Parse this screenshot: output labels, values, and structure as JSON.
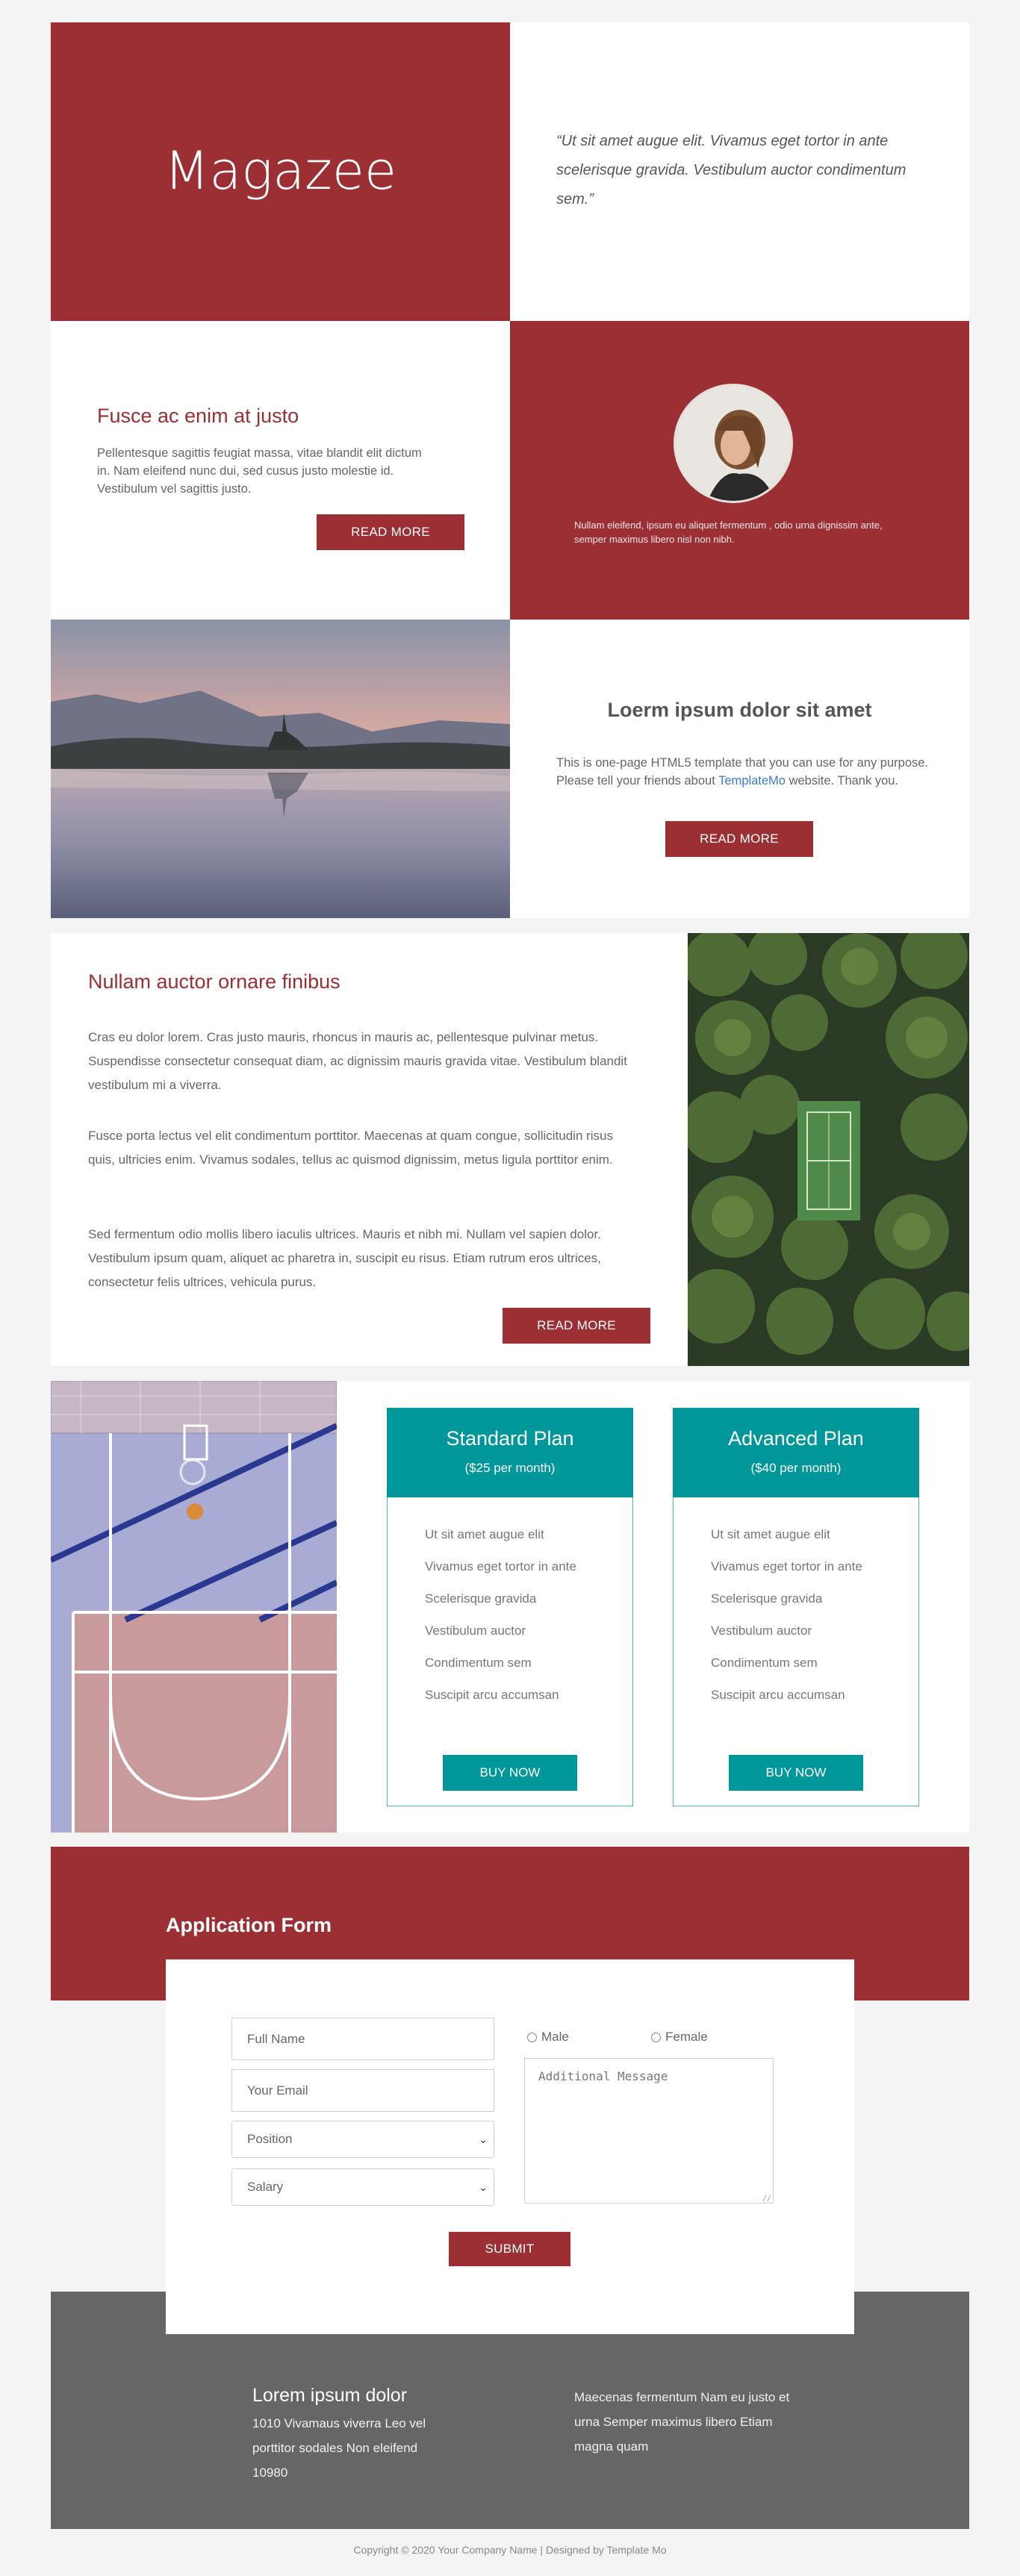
{
  "hero": {
    "brand": "Magazee",
    "quote": "“Ut sit amet augue elit. Vivamus eget tortor in ante scelerisque gravida. Vestibulum auctor condimentum sem.”"
  },
  "intro": {
    "title": "Fusce ac enim at justo",
    "text": "Pellentesque sagittis feugiat massa, vitae blandit elit dictum in. Nam eleifend nunc dui, sed cusus justo molestie id. Vestibulum vel sagittis justo.",
    "button": "READ MORE"
  },
  "profile": {
    "text": "Nullam eleifend, ipsum eu aliquet fermentum , odio urna dignissim ante, semper maximus libero nisl non nibh."
  },
  "about": {
    "title": "Loerm ipsum dolor sit amet",
    "text_before": "This is one-page HTML5 template that you can use for any purpose. Please tell your friends about",
    "link": "TemplateMo",
    "text_after": "website. Thank you.",
    "button": "READ MORE"
  },
  "article": {
    "title": "Nullam auctor ornare finibus",
    "p1": "Cras eu dolor lorem. Cras justo mauris, rhoncus in mauris ac, pellentesque pulvinar metus. Suspendisse consectetur consequat diam, ac dignissim mauris gravida vitae. Vestibulum blandit vestibulum mi a viverra.",
    "p2": "Fusce porta lectus vel elit condimentum porttitor. Maecenas at quam congue, sollicitudin risus quis, ultricies enim. Vivamus sodales, tellus ac quismod dignissim, metus ligula porttitor enim.",
    "p3": "Sed fermentum odio mollis libero iaculis ultrices. Mauris et nibh mi. Nullam vel sapien dolor. Vestibulum ipsum quam, aliquet ac pharetra in, suscipit eu risus. Etiam rutrum eros ultrices, consectetur felis ultrices, vehicula purus.",
    "button": "READ MORE"
  },
  "plans": [
    {
      "name": "Standard Plan",
      "price": "($25 per month)",
      "features": [
        "Ut sit amet augue elit",
        "Vivamus eget tortor in ante",
        "Scelerisque gravida",
        "Vestibulum auctor",
        "Condimentum sem",
        "Suscipit arcu accumsan"
      ],
      "button": "BUY NOW"
    },
    {
      "name": "Advanced Plan",
      "price": "($40 per month)",
      "features": [
        "Ut sit amet augue elit",
        "Vivamus eget tortor in ante",
        "Scelerisque gravida",
        "Vestibulum auctor",
        "Condimentum sem",
        "Suscipit arcu accumsan"
      ],
      "button": "BUY NOW"
    }
  ],
  "form": {
    "title": "Application Form",
    "name_placeholder": "Full Name",
    "email_placeholder": "Your Email",
    "position": "Position",
    "salary": "Salary",
    "male": "Male",
    "female": "Female",
    "message_placeholder": "Additional Message",
    "submit": "SUBMIT"
  },
  "footer": {
    "title": "Lorem ipsum dolor",
    "address": "1010 Vivamaus viverra Leo vel porttitor sodales Non eleifend 10980",
    "note": "Maecenas fermentum Nam eu justo et urna Semper maximus libero Etiam magna quam",
    "copyright": "Copyright © 2020 Your Company Name | Designed by Template Mo"
  },
  "colors": {
    "brand_red": "#9b2f34",
    "teal": "#00979a",
    "footer_gray": "#666666",
    "link_blue": "#3a7bd5"
  }
}
